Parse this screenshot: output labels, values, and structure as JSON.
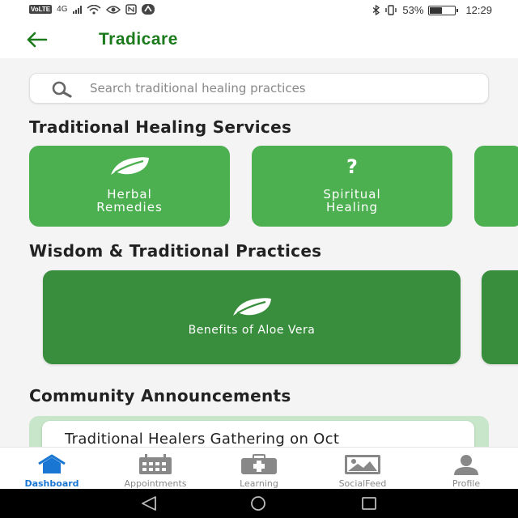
{
  "status_bar": {
    "volte": "VoLTE",
    "network": "4G",
    "battery_text": "53%",
    "battery_level": 0.53,
    "time": "12:29"
  },
  "header": {
    "back_icon": "arrow-left-icon",
    "title": "Tradicare"
  },
  "search": {
    "icon": "search-icon",
    "placeholder": "Search traditional healing practices",
    "value": ""
  },
  "services": {
    "title": "Traditional Healing Services",
    "items": [
      {
        "icon": "leaf-icon",
        "label_line1": "Herbal",
        "label_line2": "Remedies"
      },
      {
        "icon": "question-icon",
        "glyph": "?",
        "label_line1": "Spiritual",
        "label_line2": "Healing"
      }
    ]
  },
  "wisdom": {
    "title": "Wisdom & Traditional Practices",
    "items": [
      {
        "icon": "leaf-icon",
        "label": "Benefits of Aloe Vera"
      }
    ]
  },
  "announcements": {
    "title": "Community Announcements",
    "items": [
      {
        "title": "Traditional Healers Gathering on Oct"
      }
    ]
  },
  "bottom_nav": {
    "items": [
      {
        "label": "Dashboard",
        "icon": "home-icon",
        "active": true
      },
      {
        "label": "Appointments",
        "icon": "calendar-icon",
        "active": false
      },
      {
        "label": "Learning",
        "icon": "medical-kit-icon",
        "active": false
      },
      {
        "label": "SocialFeed",
        "icon": "image-icon",
        "active": false
      },
      {
        "label": "Profile",
        "icon": "person-icon",
        "active": false
      }
    ]
  },
  "colors": {
    "brand_green": "#1b7a1b",
    "card_green": "#4caf50",
    "card_dark_green": "#388e3c",
    "announcement_bg": "#c8e6c9",
    "nav_active": "#1976d2",
    "nav_inactive": "#888888"
  }
}
